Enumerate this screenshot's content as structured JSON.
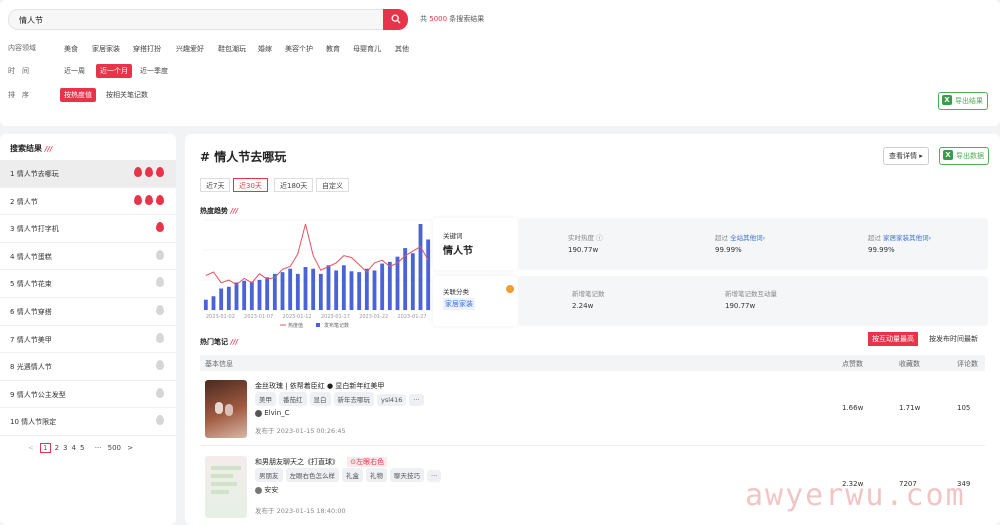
{
  "search": {
    "query": "情人节",
    "count_prefix": "共",
    "count": "5000",
    "count_suffix": "条搜索结果"
  },
  "filters": {
    "content_label": "内容领域",
    "content_items": [
      "美食",
      "家居家装",
      "穿搭打扮",
      "兴趣爱好",
      "鞋包潮玩",
      "婚嫁",
      "美容个护",
      "教育",
      "母婴育儿",
      "其他"
    ],
    "time_label": "时　间",
    "time_items": [
      "近一周",
      "近一个月",
      "近一季度"
    ],
    "time_selected": 1,
    "sort_label": "排　序",
    "sort_items": [
      "按热度值",
      "按相关笔记数"
    ],
    "sort_selected": 0
  },
  "export_label": "导出结果",
  "export_data_label": "导出数据",
  "sidebar": {
    "title": "搜索结果",
    "items": [
      {
        "rank": "1",
        "label": "情人节去哪玩",
        "heat": 3
      },
      {
        "rank": "2",
        "label": "情人节",
        "heat": 3
      },
      {
        "rank": "3",
        "label": "情人节打字机",
        "heat": 1
      },
      {
        "rank": "4",
        "label": "情人节蛋糕",
        "heat": 0
      },
      {
        "rank": "5",
        "label": "情人节花束",
        "heat": 0
      },
      {
        "rank": "6",
        "label": "情人节穿搭",
        "heat": 0
      },
      {
        "rank": "7",
        "label": "情人节美甲",
        "heat": 0
      },
      {
        "rank": "8",
        "label": "光遇情人节",
        "heat": 0
      },
      {
        "rank": "9",
        "label": "情人节公主发型",
        "heat": 0
      },
      {
        "rank": "10",
        "label": "情人节限定",
        "heat": 0
      }
    ],
    "pager": {
      "prev": "<",
      "pages": [
        "1",
        "2",
        "3",
        "4",
        "5"
      ],
      "ellipsis": "···",
      "last": "500",
      "next": ">"
    }
  },
  "main": {
    "title": "# 情人节去哪玩",
    "detail_btn": "查看详情",
    "tabs": [
      "近7天",
      "近30天",
      "近180天",
      "自定义"
    ],
    "tab_selected": 1,
    "trend_title": "热度趋势",
    "keyword_label": "关键词",
    "keyword": "情人节",
    "heat_label": "实时热度",
    "heat_value": "190.77w",
    "beat_all_prefix": "超过",
    "beat_all_link": "全站其他词",
    "beat_all_value": "99.99%",
    "beat_cat_prefix": "超过",
    "beat_cat_link": "家居家装其他词",
    "beat_cat_value": "99.99%",
    "category_label": "关联分类",
    "category_value": "家居家装",
    "new_notes_label": "新增笔记数",
    "new_notes_value": "2.24w",
    "new_interact_label": "新增笔记数互动量",
    "new_interact_value": "190.77w",
    "hot_notes_title": "热门笔记",
    "sort_interact": "按互动量最高",
    "sort_time": "按发布时间最新",
    "table_headers": [
      "基本信息",
      "点赞数",
      "收藏数",
      "评论数"
    ],
    "notes": [
      {
        "title": "金丝玫瑰 | 依帮着臣红 ● 显白新年红美甲",
        "tags": [
          "美甲",
          "番茄红",
          "显白",
          "新年去哪玩",
          "ysl416",
          "···"
        ],
        "author": "Elvin_C",
        "time": "发布于 2023-01-15 00:26:45",
        "likes": "1.66w",
        "collects": "1.71w",
        "comments": "105"
      },
      {
        "title": "和男朋友聊天之《打直球》",
        "badge": "⊙左眼右色",
        "tags": [
          "男朋友",
          "左眼右色怎么样",
          "礼盒",
          "礼物",
          "聊天技巧",
          "···"
        ],
        "author": "安安",
        "time": "发布于 2023-01-15 18:40:00",
        "likes": "2.32w",
        "collects": "7207",
        "comments": "349"
      }
    ]
  },
  "chart_data": {
    "type": "bar",
    "x_ticks": [
      "2023-01-02",
      "2023-01-07",
      "2023-01-12",
      "2023-01-17",
      "2023-01-22",
      "2023-01-27"
    ],
    "legend": [
      "热度值",
      "发布笔记数"
    ],
    "series": [
      {
        "name": "热度值",
        "type": "line",
        "values": [
          38,
          42,
          30,
          33,
          28,
          35,
          30,
          40,
          34,
          36,
          45,
          48,
          62,
          95,
          60,
          44,
          48,
          52,
          60,
          58,
          50,
          42,
          52,
          55,
          48,
          52,
          60,
          65,
          70,
          55
        ]
      },
      {
        "name": "发布笔记数",
        "type": "bar",
        "values": [
          12,
          16,
          25,
          27,
          32,
          34,
          33,
          35,
          38,
          42,
          44,
          48,
          42,
          50,
          48,
          42,
          52,
          46,
          52,
          45,
          44,
          48,
          46,
          54,
          56,
          62,
          72,
          66,
          100,
          82
        ]
      }
    ],
    "colors": [
      "#e8515f",
      "#4a63d6"
    ]
  }
}
